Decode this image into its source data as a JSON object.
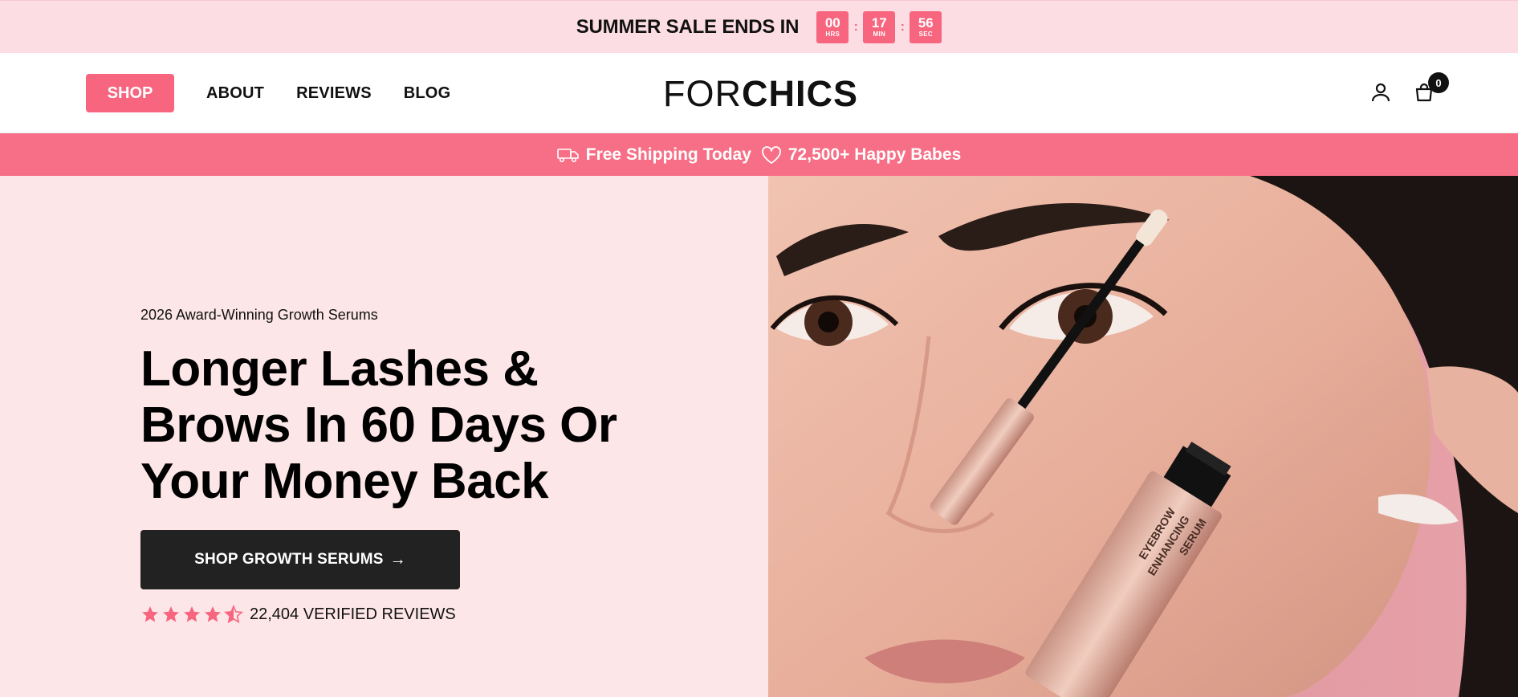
{
  "announcement": {
    "text": "SUMMER SALE ENDS IN",
    "timer": [
      {
        "value": "00",
        "unit": "HRS"
      },
      {
        "value": "17",
        "unit": "MIN"
      },
      {
        "value": "56",
        "unit": "SEC"
      }
    ],
    "separator": ":"
  },
  "header": {
    "nav": {
      "shop": "SHOP",
      "about": "ABOUT",
      "reviews": "REVIEWS",
      "blog": "BLOG"
    },
    "logo": {
      "light": "FOR",
      "bold": "CHICS"
    },
    "cart_count": "0",
    "icons": [
      "account-icon",
      "cart-icon"
    ]
  },
  "promo": {
    "shipping": "Free Shipping Today",
    "customers": "72,500+ Happy Babes"
  },
  "hero": {
    "eyebrow": "2026 Award-Winning Growth Serums",
    "headline": "Longer Lashes & Brows In 60 Days Or Your Money Back",
    "cta": "SHOP GROWTH SERUMS",
    "cta_arrow": "→",
    "rating": 4.5,
    "reviews_text": "22,404 VERIFIED REVIEWS",
    "product_label_1": "EYEBROW",
    "product_label_2": "ENHANCING",
    "product_label_3": "SERUM"
  },
  "colors": {
    "accent": "#f7657f",
    "announcement_bg": "#fcdde3",
    "hero_bg": "#fde6e7",
    "cta_bg": "#222222"
  }
}
